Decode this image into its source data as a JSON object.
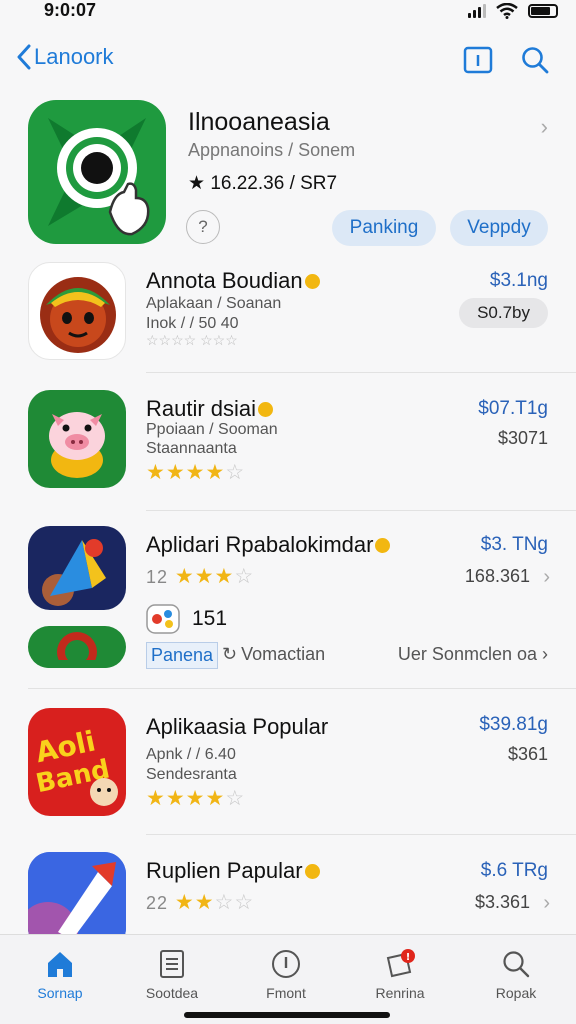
{
  "status": {
    "time": "9:0:07"
  },
  "nav": {
    "back_label": "Lanoork"
  },
  "featured": {
    "title": "Ilnooaneasia",
    "subtitle": "Appnanoins / Sonem",
    "rating": "16.22.36 / SR7",
    "info_glyph": "?",
    "button1": "Panking",
    "button2": "Veppdy"
  },
  "apps": [
    {
      "title": "Annota Boudian",
      "line1": "Aplakaan / Soanan",
      "line2": "Inok / / 50 40",
      "line3": "☆☆☆☆ ☆☆☆",
      "price": "$3.1ng",
      "pill": "S0.7by"
    },
    {
      "title": "Rautir dsiai",
      "line1": "Ppoiaan / Sooman",
      "line2": "Staannaanta",
      "stars": 4,
      "price": "$07.T1g",
      "price2": "$3071"
    },
    {
      "title": "Aplidari Rpabalokimdar",
      "stars_prefix": "12",
      "stars": 3,
      "price": "$3. TNg",
      "price2": "168.361",
      "count": "151",
      "tag": "Panena",
      "action": "Vomactian",
      "more_link": "Uer Sonmclen oa"
    },
    {
      "title": "Aplikaasia Popular",
      "line1": "Apnk / / 6.40",
      "line2": "Sendesranta",
      "stars": 4,
      "price": "$39.81g",
      "price2": "$361"
    },
    {
      "title": "Ruplien Papular",
      "stars_prefix": "22",
      "stars": 2,
      "price": "$.6 TRg",
      "price2": "$3.361"
    }
  ],
  "tabs": [
    {
      "label": "Sornap",
      "icon": "home-icon",
      "active": true
    },
    {
      "label": "Sootdea",
      "icon": "document-icon"
    },
    {
      "label": "Fmont",
      "icon": "info-icon"
    },
    {
      "label": "Renrina",
      "icon": "notification-icon"
    },
    {
      "label": "Ropak",
      "icon": "search-icon"
    }
  ],
  "colors": {
    "accent": "#1f7bd8",
    "star": "#f1b515",
    "price": "#2a62b8"
  }
}
